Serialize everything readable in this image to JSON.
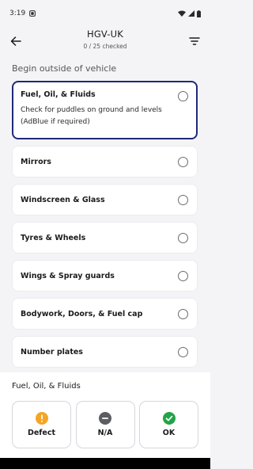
{
  "status_bar": {
    "time": "3:19"
  },
  "header": {
    "title": "HGV-UK",
    "progress": "0 / 25 checked"
  },
  "section": {
    "title": "Begin outside of vehicle"
  },
  "items": [
    {
      "label": "Fuel, Oil, & Fluids",
      "description": "Check for puddles on ground and levels (AdBlue if required)",
      "selected": false,
      "active": true
    },
    {
      "label": "Mirrors",
      "selected": false
    },
    {
      "label": "Windscreen & Glass",
      "selected": false
    },
    {
      "label": "Tyres & Wheels",
      "selected": false
    },
    {
      "label": "Wings & Spray guards",
      "selected": false
    },
    {
      "label": "Bodywork, Doors, & Fuel cap",
      "selected": false
    },
    {
      "label": "Number plates",
      "selected": false
    }
  ],
  "bottom_sheet": {
    "title": "Fuel, Oil, & Fluids",
    "actions": [
      {
        "label": "Defect",
        "icon": "warning-icon",
        "color": "#f5a524"
      },
      {
        "label": "N/A",
        "icon": "minus-circle-icon",
        "color": "#5c5d63"
      },
      {
        "label": "OK",
        "icon": "check-circle-icon",
        "color": "#22a447"
      }
    ]
  },
  "colors": {
    "accent": "#1e2a78",
    "background": "#f4f4f6"
  }
}
